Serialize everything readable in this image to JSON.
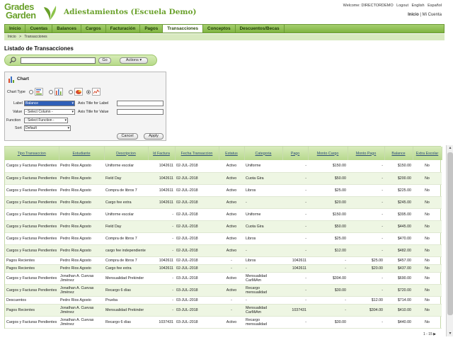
{
  "brand": {
    "line1": "Grades",
    "line2": "Garden",
    "leaf_color": "#6aa12b"
  },
  "app_title": "Adiestamientos (Escuela Demo)",
  "welcome": {
    "text": "Welcome: DIRECTORDEMO",
    "logout": "Logout",
    "english": "English",
    "espanol": "Español"
  },
  "account": {
    "inicio": "Inicio",
    "sep": " | ",
    "mi_cuenta": "Mi Cuenta"
  },
  "nav": [
    "Inicio",
    "Cuentas",
    "Balances",
    "Cargos",
    "Facturación",
    "Pagos",
    "Transacciones",
    "Conceptos",
    "Descuentos/Becas"
  ],
  "nav_active": "Transacciones",
  "breadcrumb": {
    "home": "Inicio",
    "sep": ">",
    "current": "Transacciones"
  },
  "page_title": "Listado de Transacciones",
  "search": {
    "value": "",
    "go": "Go",
    "actions": "Actions ▾"
  },
  "chart_panel": {
    "title": "Chart",
    "chart_type_label": "Chart Type",
    "label_label": "Label",
    "label_value": "Balance",
    "axis_label_label": "Axis Title for Label",
    "value_label": "Value",
    "value_value": "- Select Column -",
    "axis_value_label": "Axis Title for Value",
    "function_label": "Function",
    "function_value": "- Select Function -",
    "sort_label": "Sort",
    "sort_value": "Default",
    "cancel": "Cancel",
    "apply": "Apply"
  },
  "table": {
    "headers": [
      "Tipo Transaccion",
      "Estudiante",
      "Descripcion",
      "Id Factura",
      "Fecha Transaccion",
      "Estatus",
      "Categoria",
      "Pago",
      "Monto Cargo",
      "Monto Pago",
      "Balance",
      "Extra Escolar"
    ],
    "rows": [
      [
        "Cargos y Facturas Pendientes",
        "Pedro Rios Agosto",
        "Uniforme escolar",
        "1042611",
        "02-JUL-2018",
        "Activo",
        "Uniforme",
        "-",
        "$150.00",
        "-",
        "$150.00",
        "No"
      ],
      [
        "Cargos y Facturas Pendientes",
        "Pedro Rios Agosto",
        "Field Day",
        "1042611",
        "02-JUL-2018",
        "Activo",
        "Cuota Gira",
        "-",
        "$50.00",
        "-",
        "$200.00",
        "No"
      ],
      [
        "Cargos y Facturas Pendientes",
        "Pedro Rios Agosto",
        "Compra de libros 7",
        "1042611",
        "02-JUL-2018",
        "Activo",
        "Libros",
        "-",
        "$25.00",
        "-",
        "$225.00",
        "No"
      ],
      [
        "Cargos y Facturas Pendientes",
        "Pedro Rios Agosto",
        "Cargo fee extra",
        "1042611",
        "02-JUL-2018",
        "Activo",
        "-",
        "-",
        "$20.00",
        "-",
        "$245.00",
        "No"
      ],
      [
        "Cargos y Facturas Pendientes",
        "Pedro Rios Agosto",
        "Uniforme escolar",
        "-",
        "02-JUL-2018",
        "Activo",
        "Uniforme",
        "-",
        "$150.00",
        "-",
        "$395.00",
        "No"
      ],
      [
        "Cargos y Facturas Pendientes",
        "Pedro Rios Agosto",
        "Field Day",
        "-",
        "02-JUL-2018",
        "Activo",
        "Cuota Gira",
        "-",
        "$50.00",
        "-",
        "$445.00",
        "No"
      ],
      [
        "Cargos y Facturas Pendientes",
        "Pedro Rios Agosto",
        "Compra de libros 7",
        "-",
        "02-JUL-2018",
        "Activo",
        "Libros",
        "-",
        "$25.00",
        "-",
        "$470.00",
        "No"
      ],
      [
        "Cargos y Facturas Pendientes",
        "Pedro Rios Agosto",
        "cargo fee independiente",
        "-",
        "02-JUL-2018",
        "Activo",
        "-",
        "-",
        "$12.00",
        "-",
        "$482.00",
        "No"
      ],
      [
        "Pagos Recientes",
        "Pedro Rios Agosto",
        "Compra de libros 7",
        "1042611",
        "02-JUL-2018",
        "-",
        "Libros",
        "1042611",
        "-",
        "$25.00",
        "$457.00",
        "No"
      ],
      [
        "Pagos Recientes",
        "Pedro Rios Agosto",
        "Cargo fee extra",
        "1042611",
        "02-JUL-2018",
        "-",
        "-",
        "1042611",
        "-",
        "$20.00",
        "$437.00",
        "No"
      ],
      [
        "Cargos y Facturas Pendientes",
        "Jonathan A. Cuevas Jiménez",
        "Mensualidad Prekinder",
        "-",
        "03-JUL-2018",
        "Activo",
        "Mensualidad CarMiAm",
        "-",
        "$304.00",
        "-",
        "$690.00",
        "No"
      ],
      [
        "Cargos y Facturas Pendientes",
        "Jonathan A. Cuevas Jiménez",
        "Recargo 6 días",
        "-",
        "03-JUL-2018",
        "Activo",
        "Recargo mensualidad",
        "-",
        "$30.00",
        "-",
        "$720.00",
        "No"
      ],
      [
        "Descuentos",
        "Pedro Rios Agosto",
        "Prueba",
        "-",
        "03-JUL-2018",
        "-",
        "-",
        "-",
        "-",
        "$12.00",
        "$714.00",
        "No"
      ],
      [
        "Pagos Recientes",
        "Jonathan A. Cuevas Jiménez",
        "Mensualidad Prekinder",
        "-",
        "03-JUL-2018",
        "-",
        "Mensualidad CarMiAm",
        "1037431",
        "-",
        "$304.00",
        "$410.00",
        "No"
      ],
      [
        "Cargos y Facturas Pendientes",
        "Jonathan A. Cuevas Jiménez",
        "Recargo 6 días",
        "1037431",
        "03-JUL-2018",
        "Activo",
        "Recargo mensualidad",
        "-",
        "$30.00",
        "-",
        "$440.00",
        "No"
      ]
    ]
  },
  "pager": "1 - 15 ▶"
}
